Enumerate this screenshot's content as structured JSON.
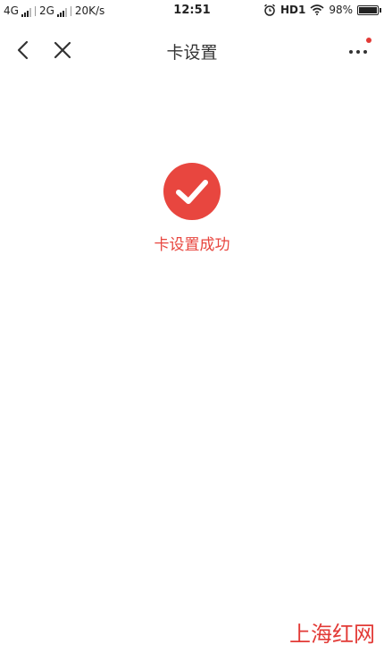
{
  "status_bar": {
    "net1": "4G",
    "net2": "2G",
    "speed": "20K/s",
    "time": "12:51",
    "hd": "HD1",
    "battery_percent": "98%",
    "battery_level": 0.98
  },
  "nav": {
    "title": "卡设置",
    "badge_color": "#e23a36"
  },
  "result": {
    "message": "卡设置成功",
    "accent_color": "#e8463f",
    "icon": "check-circle-icon"
  },
  "watermark": {
    "text": "上海红网"
  }
}
